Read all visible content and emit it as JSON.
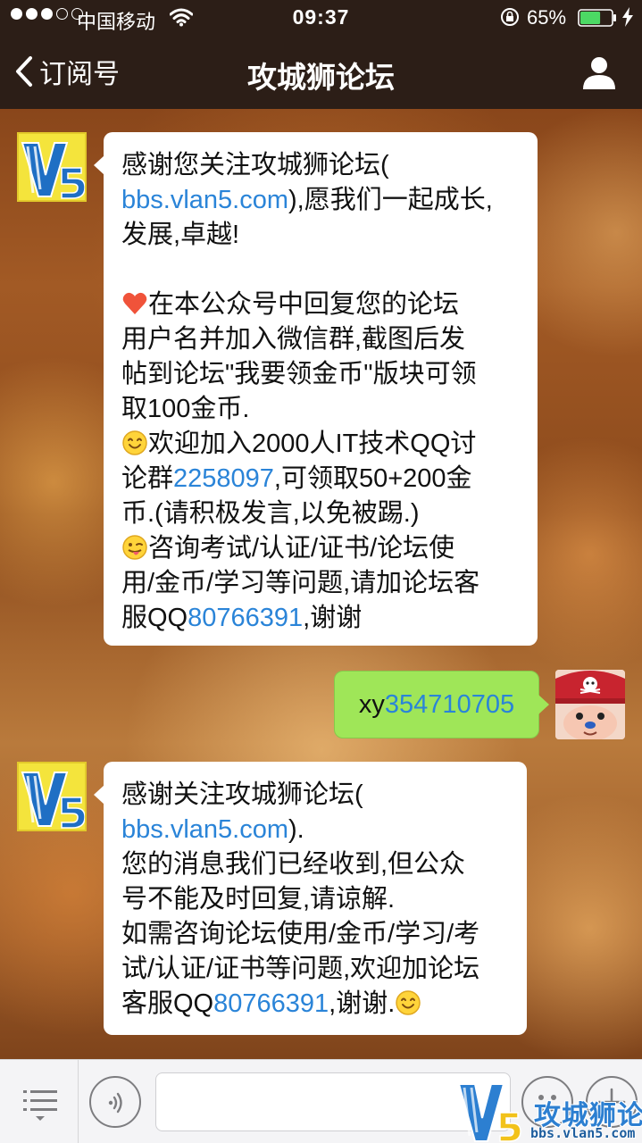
{
  "status_bar": {
    "signal_dots_filled": 3,
    "signal_dots_total": 5,
    "carrier": "中国移动",
    "time": "09:37",
    "battery_percent": "65%",
    "battery_level": 0.65
  },
  "nav": {
    "back_label": "订阅号",
    "title": "攻城狮论坛"
  },
  "messages": {
    "m1": {
      "line1": "感谢您关注攻城狮论坛(",
      "link1": "bbs.vlan5.com",
      "line2_rest": "),愿我们一起成长,",
      "line3": "发展,卓越!",
      "p2_line1": "在本公众号中回复您的论坛",
      "p2_line2": "用户名并加入微信群,截图后发",
      "p2_line3": "帖到论坛\"我要领金币\"版块可领",
      "p2_line4": "取100金币.",
      "p3_line1": "欢迎加入2000人IT技术QQ讨",
      "p3_line2_pre": "论群",
      "p3_group": "2258097",
      "p3_line2_post": ",可领取50+200金",
      "p3_line3": "币.(请积极发言,以免被踢.)",
      "p4_line1": "咨询考试/认证/证书/论坛使",
      "p4_line2": "用/金币/学习等问题,请加论坛客",
      "p4_line3_pre": "服QQ",
      "p4_qq": "80766391",
      "p4_line3_post": ",谢谢"
    },
    "m2": {
      "prefix": "xy",
      "number": "354710705"
    },
    "m3": {
      "line1": "感谢关注攻城狮论坛(",
      "link1": "bbs.vlan5.com",
      "line2_rest": ").",
      "line3": "您的消息我们已经收到,但公众",
      "line4": "号不能及时回复,请谅解.",
      "line5": "如需咨询论坛使用/金币/学习/考",
      "line6": "试/认证/证书等问题,欢迎加论坛",
      "line7_pre": "客服QQ",
      "qq": "80766391",
      "line7_post": ",谢谢."
    }
  },
  "avatars": {
    "v5_logo": "V5"
  },
  "watermark": {
    "title": "攻城狮论坛",
    "url": "bbs.vlan5.com"
  },
  "icons": {
    "back": "chevron-left-icon",
    "profile": "person-icon",
    "menu": "menu-list-icon",
    "voice": "voice-icon",
    "emoji": "smiley-icon",
    "plus": "plus-icon"
  },
  "colors": {
    "bar_bg": "#2c1e17",
    "link": "#2a84d8",
    "my_bubble": "#9fe658",
    "battery": "#4cd964"
  }
}
